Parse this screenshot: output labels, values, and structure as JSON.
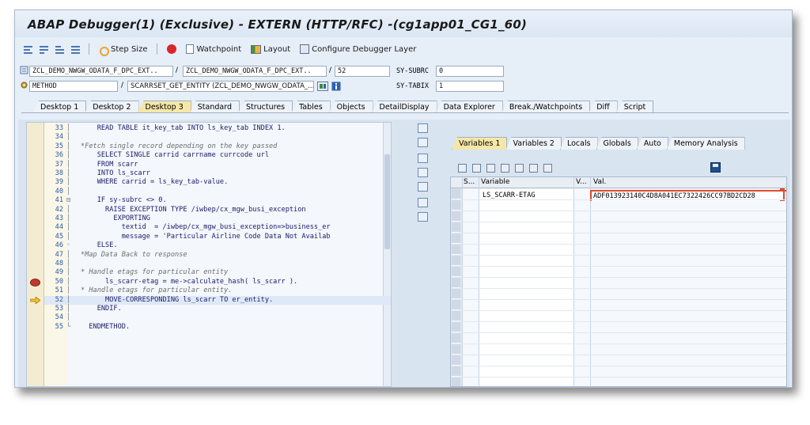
{
  "window": {
    "title": "ABAP Debugger(1)  (Exclusive) - EXTERN (HTTP/RFC) -(cg1app01_CG1_60)"
  },
  "toolbar": {
    "step_size": "Step Size",
    "watchpoint": "Watchpoint",
    "layout": "Layout",
    "configure": "Configure Debugger Layer"
  },
  "info": {
    "program": "ZCL_DEMO_NWGW_ODATA_F_DPC_EXT..",
    "include": "ZCL_DEMO_NWGW_ODATA_F_DPC_EXT..",
    "line": "52",
    "sy_subrc_label": "SY-SUBRC",
    "sy_subrc_value": "0",
    "event_type": "METHOD",
    "event_name": "SCARRSET_GET_ENTITY (ZCL_DEMO_NWGW_ODATA_...",
    "sy_tabix_label": "SY-TABIX",
    "sy_tabix_value": "1"
  },
  "main_tabs": [
    {
      "label": "Desktop 1",
      "active": false
    },
    {
      "label": "Desktop 2",
      "active": false
    },
    {
      "label": "Desktop 3",
      "active": true
    },
    {
      "label": "Standard",
      "active": false
    },
    {
      "label": "Structures",
      "active": false
    },
    {
      "label": "Tables",
      "active": false
    },
    {
      "label": "Objects",
      "active": false
    },
    {
      "label": "DetailDisplay",
      "active": false
    },
    {
      "label": "Data Explorer",
      "active": false
    },
    {
      "label": "Break./Watchpoints",
      "active": false
    },
    {
      "label": "Diff",
      "active": false
    },
    {
      "label": "Script",
      "active": false
    }
  ],
  "code": [
    {
      "n": "33",
      "t": "    READ TABLE it_key_tab INTO ls_key_tab INDEX 1.",
      "cls": "txt"
    },
    {
      "n": "34",
      "t": "",
      "cls": "txt"
    },
    {
      "n": "35",
      "t": "*Fetch single record depending on the key passed",
      "cls": "cm"
    },
    {
      "n": "36",
      "t": "    SELECT SINGLE carrid carrname currcode url",
      "cls": "txt"
    },
    {
      "n": "37",
      "t": "    FROM scarr",
      "cls": "txt"
    },
    {
      "n": "38",
      "t": "    INTO ls_scarr",
      "cls": "txt"
    },
    {
      "n": "39",
      "t": "    WHERE carrid = ls_key_tab-value.",
      "cls": "txt"
    },
    {
      "n": "40",
      "t": "",
      "cls": "txt"
    },
    {
      "n": "41",
      "t": "    IF sy-subrc <> 0.",
      "cls": "txt"
    },
    {
      "n": "42",
      "t": "      RAISE EXCEPTION TYPE /iwbep/cx_mgw_busi_exception",
      "cls": "txt"
    },
    {
      "n": "43",
      "t": "        EXPORTING",
      "cls": "txt"
    },
    {
      "n": "44",
      "t": "          textid  = /iwbep/cx_mgw_busi_exception=>business_er",
      "cls": "txt"
    },
    {
      "n": "45",
      "t": "          message = 'Particular Airline Code Data Not Availab",
      "cls": "txt"
    },
    {
      "n": "46",
      "t": "    ELSE.",
      "cls": "txt"
    },
    {
      "n": "47",
      "t": "*Map Data Back to response",
      "cls": "cm"
    },
    {
      "n": "48",
      "t": "",
      "cls": "txt"
    },
    {
      "n": "49",
      "t": "* Handle etags for particular entity",
      "cls": "cm"
    },
    {
      "n": "50",
      "t": "      ls_scarr-etag = me->calculate_hash( ls_scarr ).",
      "cls": "txt"
    },
    {
      "n": "51",
      "t": "* Handle etags for particular entity.",
      "cls": "cm"
    },
    {
      "n": "52",
      "t": "      MOVE-CORRESPONDING ls_scarr TO er_entity.",
      "cls": "txt"
    },
    {
      "n": "53",
      "t": "    ENDIF.",
      "cls": "txt"
    },
    {
      "n": "54",
      "t": "",
      "cls": "txt"
    },
    {
      "n": "55",
      "t": "  ENDMETHOD.",
      "cls": "txt"
    }
  ],
  "var_tabs": [
    {
      "label": "Variables 1",
      "active": true
    },
    {
      "label": "Variables 2",
      "active": false
    },
    {
      "label": "Locals",
      "active": false
    },
    {
      "label": "Globals",
      "active": false
    },
    {
      "label": "Auto",
      "active": false
    },
    {
      "label": "Memory Analysis",
      "active": false
    }
  ],
  "grid": {
    "col_s": "S...",
    "col_variable": "Variable",
    "col_v": "V...",
    "col_val": "Val.",
    "variable": "LS_SCARR-ETAG",
    "value": "ADF013923140C4D8A041EC7322426CC97BD2CD28"
  }
}
